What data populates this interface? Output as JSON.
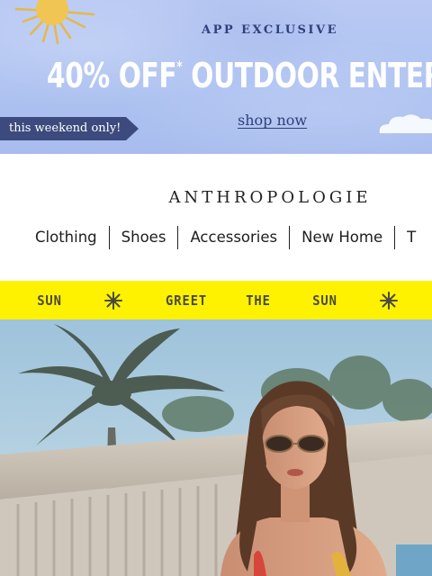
{
  "promo": {
    "eyebrow": "APP EXCLUSIVE",
    "headline": "40% OFF",
    "headline_mark": "*",
    "headline_rest": " OUTDOOR ENTERTAI",
    "tag": "this weekend only!",
    "link": "shop now",
    "colors": {
      "background": "#aec2f1",
      "tag": "#3c4a7e",
      "ink": "#2f3f7a"
    }
  },
  "header": {
    "logo": "ANTHROPOLOGIE",
    "nav": [
      {
        "label": "Clothing"
      },
      {
        "label": "Shoes"
      },
      {
        "label": "Accessories"
      },
      {
        "label": "New Home"
      },
      {
        "label": "T"
      }
    ]
  },
  "ticker": {
    "color": "#fff200",
    "w1": "SUN",
    "w2": "GREET",
    "w3": "THE",
    "w4": "SUN",
    "star_icon": "sparkle-icon"
  },
  "hero": {
    "image": "woman-in-sunglasses-poolside-photo"
  }
}
